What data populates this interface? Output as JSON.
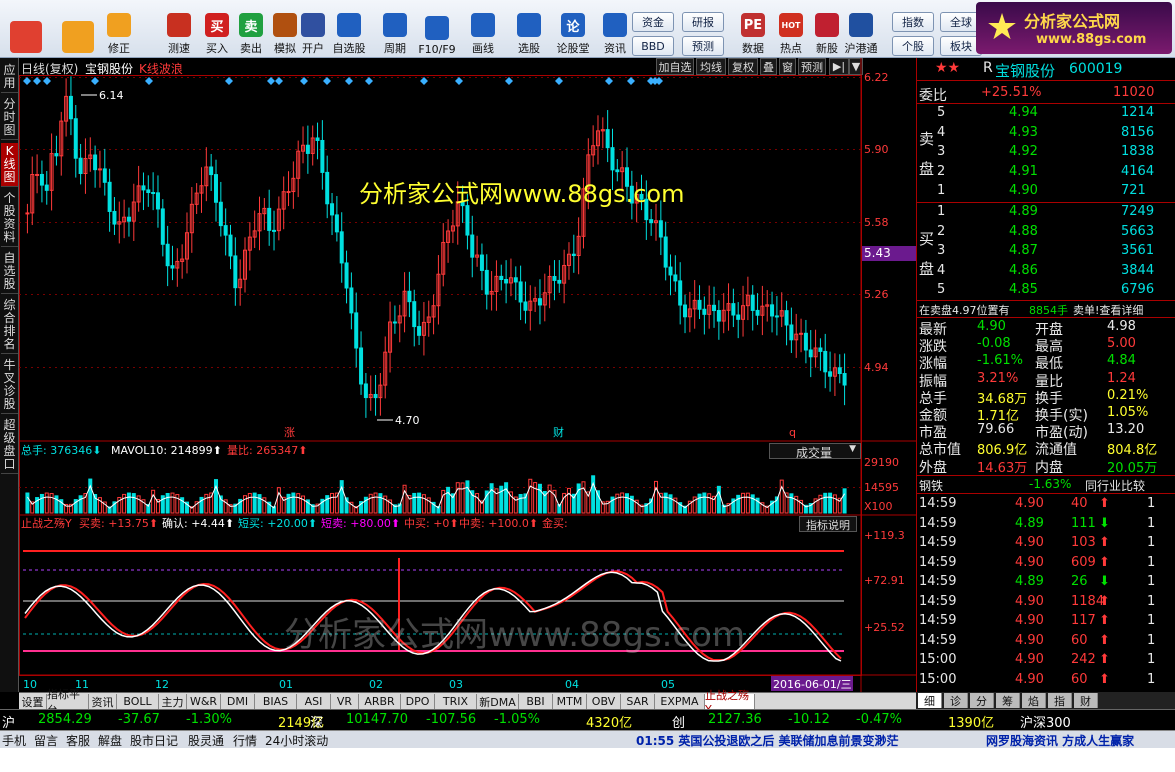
{
  "toolbar": {
    "buttons": [
      {
        "label": "",
        "icon": "windows-icon"
      },
      {
        "label": "",
        "icon": "back-arrow-icon"
      },
      {
        "label": "修正",
        "icon": "up-down-arrows-icon"
      },
      {
        "label": "测速",
        "icon": "clock-icon"
      },
      {
        "label": "买入",
        "icon": "buy-icon",
        "glyph": "买"
      },
      {
        "label": "卖出",
        "icon": "sell-icon",
        "glyph": "卖"
      },
      {
        "label": "模拟",
        "icon": "hammer-icon"
      },
      {
        "label": "开户",
        "icon": "person-icon"
      },
      {
        "label": "自选股",
        "icon": "star-folder-icon"
      },
      {
        "label": "周期",
        "icon": "period-icon"
      },
      {
        "label": "F10/F9",
        "icon": "f10-icon"
      },
      {
        "label": "画线",
        "icon": "pencil-icon"
      },
      {
        "label": "选股",
        "icon": "monitor-icon"
      },
      {
        "label": "论股堂",
        "icon": "forum-icon",
        "glyph": "论"
      },
      {
        "label": "资讯",
        "icon": "news-icon"
      },
      {
        "label": "数据",
        "icon": "pe-icon",
        "glyph": "PE"
      },
      {
        "label": "热点",
        "icon": "hot-icon",
        "glyph": "HOT"
      },
      {
        "label": "新股",
        "icon": "new-stock-icon"
      },
      {
        "label": "沪港通",
        "icon": "hk-connect-icon"
      }
    ],
    "small_buttons": [
      "资金",
      "研报",
      "BBD",
      "预测",
      "指数",
      "全球",
      "个股",
      "板块"
    ],
    "logo": {
      "title": "分析家公式网",
      "url": "www.88gs.com"
    }
  },
  "left_tabs": [
    "应用",
    "分时图",
    "K线图",
    "个股资料",
    "自选股",
    "综合排名",
    "牛叉诊股",
    "超级盘口"
  ],
  "chart_header": {
    "mode": "日线(复权)",
    "stock": "宝钢股份",
    "indicator": "K线波浪",
    "buttons": [
      "加自选",
      "均线",
      "复权",
      "叠",
      "窗",
      "预测"
    ]
  },
  "watermark_top": "分析家公式网www.88gs.com",
  "watermark_bottom": "分析家公式网www.88gs.com",
  "price_axis": [
    "6.22",
    "5.90",
    "5.58",
    "5.26",
    "4.94"
  ],
  "current_price_tag": "5.43",
  "price_high_label": "6.14",
  "price_low_label": "4.70",
  "event_marks": [
    "涨",
    "财",
    "q"
  ],
  "volume_header": {
    "total_label": "总手:",
    "total_value": "376346",
    "mavol_label": "MAVOL10:",
    "mavol_value": "214899",
    "ratio_label": "量比:",
    "ratio_value": "265347",
    "selector": "成交量"
  },
  "volume_axis": [
    "29190",
    "14595",
    "X100"
  ],
  "indicator_header": {
    "name": "止战之殇Y",
    "items": [
      {
        "label": "买卖:",
        "value": "+13.75"
      },
      {
        "label": "确认:",
        "value": "+4.44"
      },
      {
        "label": "短买:",
        "value": "+20.00"
      },
      {
        "label": "短卖:",
        "value": "+80.00"
      },
      {
        "label": "中买:",
        "value": "+0"
      },
      {
        "label": "中卖:",
        "value": "+100.0"
      },
      {
        "label": "金买:",
        "value": ""
      }
    ],
    "help_button": "指标说明"
  },
  "indicator_axis": [
    "+119.3",
    "+72.91",
    "+25.52"
  ],
  "months": [
    "10",
    "11",
    "12",
    "01",
    "02",
    "03",
    "04",
    "05"
  ],
  "date_tag": "2016-06-01/三",
  "indicator_tabs": [
    "设置",
    "指标平台",
    "资讯",
    "BOLL",
    "主力",
    "W&R",
    "DMI",
    "BIAS",
    "ASI",
    "VR",
    "ARBR",
    "DPO",
    "TRIX",
    "新DMA",
    "BBI",
    "MTM",
    "OBV",
    "SAR",
    "EXPMA",
    "止战之殇Y"
  ],
  "quote": {
    "code": "600019",
    "name": "宝钢股份",
    "prefix": "R",
    "weibi_label": "委比",
    "weibi_value": "+25.51%",
    "weibi_diff": "11020",
    "sell": [
      {
        "lvl": "5",
        "price": "4.94",
        "vol": "1214"
      },
      {
        "lvl": "4",
        "price": "4.93",
        "vol": "8156"
      },
      {
        "lvl": "3",
        "price": "4.92",
        "vol": "1838"
      },
      {
        "lvl": "2",
        "price": "4.91",
        "vol": "4164"
      },
      {
        "lvl": "1",
        "price": "4.90",
        "vol": "721"
      }
    ],
    "buy": [
      {
        "lvl": "1",
        "price": "4.89",
        "vol": "7249"
      },
      {
        "lvl": "2",
        "price": "4.88",
        "vol": "5663"
      },
      {
        "lvl": "3",
        "price": "4.87",
        "vol": "3561"
      },
      {
        "lvl": "4",
        "price": "4.86",
        "vol": "3844"
      },
      {
        "lvl": "5",
        "price": "4.85",
        "vol": "6796"
      }
    ],
    "sell_label": "卖盘",
    "buy_label": "买盘",
    "order_note": "在卖盘4.97位置有",
    "order_note_vol": "8854手",
    "order_note_link": "卖单!查看详细",
    "stats": [
      {
        "l1": "最新",
        "v1": "4.90",
        "l2": "开盘",
        "v2": "4.98"
      },
      {
        "l1": "涨跌",
        "v1": "-0.08",
        "l2": "最高",
        "v2": "5.00"
      },
      {
        "l1": "涨幅",
        "v1": "-1.61%",
        "l2": "最低",
        "v2": "4.84"
      },
      {
        "l1": "振幅",
        "v1": "3.21%",
        "l2": "量比",
        "v2": "1.24"
      },
      {
        "l1": "总手",
        "v1": "34.68万",
        "l2": "换手",
        "v2": "0.21%"
      },
      {
        "l1": "金额",
        "v1": "1.71亿",
        "l2": "换手(实)",
        "v2": "1.05%"
      },
      {
        "l1": "市盈",
        "v1": "79.66",
        "l2": "市盈(动)",
        "v2": "13.20"
      },
      {
        "l1": "总市值",
        "v1": "806.9亿",
        "l2": "流通值",
        "v2": "804.8亿"
      },
      {
        "l1": "外盘",
        "v1": "14.63万",
        "l2": "内盘",
        "v2": "20.05万"
      }
    ],
    "industry": "钢铁",
    "industry_change": "-1.63%",
    "industry_link": "同行业比较",
    "ticks": [
      {
        "time": "14:59",
        "price": "4.90",
        "vol": "40",
        "dir": "up",
        "n": "1"
      },
      {
        "time": "14:59",
        "price": "4.89",
        "vol": "111",
        "dir": "down",
        "n": "1"
      },
      {
        "time": "14:59",
        "price": "4.90",
        "vol": "103",
        "dir": "up",
        "n": "1"
      },
      {
        "time": "14:59",
        "price": "4.90",
        "vol": "609",
        "dir": "up",
        "n": "1"
      },
      {
        "time": "14:59",
        "price": "4.89",
        "vol": "26",
        "dir": "down",
        "n": "1"
      },
      {
        "time": "14:59",
        "price": "4.90",
        "vol": "1184",
        "dir": "up",
        "n": "1"
      },
      {
        "time": "14:59",
        "price": "4.90",
        "vol": "117",
        "dir": "up",
        "n": "1"
      },
      {
        "time": "14:59",
        "price": "4.90",
        "vol": "60",
        "dir": "up",
        "n": "1"
      },
      {
        "time": "15:00",
        "price": "4.90",
        "vol": "242",
        "dir": "up",
        "n": "1"
      },
      {
        "time": "15:00",
        "price": "4.90",
        "vol": "60",
        "dir": "up",
        "n": "1"
      }
    ],
    "tabs": [
      "细",
      "诊",
      "分",
      "筹",
      "焰",
      "指",
      "财"
    ]
  },
  "ticker": [
    {
      "name": "沪",
      "value": "2854.29",
      "chg": "-37.67",
      "pct": "-1.30%",
      "amt": "2149亿"
    },
    {
      "name": "深",
      "value": "10147.70",
      "chg": "-107.56",
      "pct": "-1.05%",
      "amt": "4320亿"
    },
    {
      "name": "创",
      "value": "2127.36",
      "chg": "-10.12",
      "pct": "-0.47%",
      "amt": "1390亿"
    },
    {
      "name": "沪深300",
      "value": "",
      "chg": "",
      "pct": "",
      "amt": ""
    }
  ],
  "status": {
    "items": [
      "手机",
      "留言",
      "客服",
      "解盘",
      "股市日记",
      "股灵通",
      "行情",
      "24小时滚动"
    ],
    "news": "01:55 英国公投退欧之后 美联储加息前景变渺茫",
    "slogan": "网罗股海资讯 方成人生赢家"
  },
  "colors": {
    "up": "#ff3a3a",
    "down": "#00e0e0",
    "accent": "#ffff30"
  }
}
